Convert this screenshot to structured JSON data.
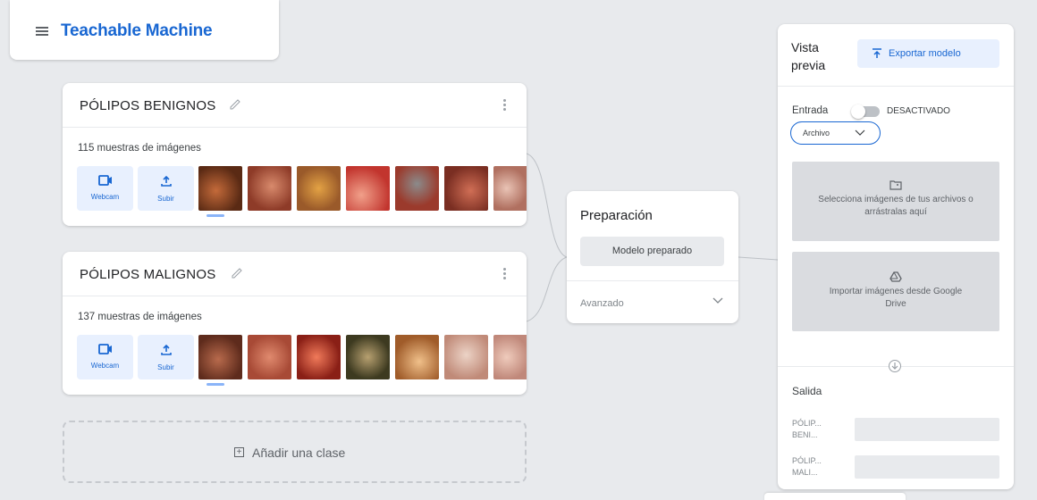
{
  "header": {
    "title": "Teachable Machine"
  },
  "classes": [
    {
      "name": "PÓLIPOS BENIGNOS",
      "sample_count": "115 muestras de imágenes",
      "webcam_label": "Webcam",
      "upload_label": "Subir",
      "thumbnails": [
        "#7a3b1e",
        "#a84a2a",
        "#c07d3f",
        "#d9544a",
        "#9b3a2c",
        "#b6523a",
        "#c98a7a"
      ]
    },
    {
      "name": "PÓLIPOS MALIGNOS",
      "sample_count": "137 muestras de imágenes",
      "webcam_label": "Webcam",
      "upload_label": "Subir",
      "thumbnails": [
        "#8c4a34",
        "#c26a52",
        "#b1382a",
        "#6b5a2a",
        "#c27d3c",
        "#d7a894",
        "#d6a38d"
      ]
    }
  ],
  "add_class": {
    "label": "Añadir una clase"
  },
  "training": {
    "title": "Preparación",
    "button_label": "Modelo preparado",
    "advanced_label": "Avanzado"
  },
  "preview": {
    "title": "Vista previa",
    "export_label": "Exportar modelo",
    "input_label": "Entrada",
    "toggle_state": "DESACTIVADO",
    "source_value": "Archivo",
    "file_drop_text": "Selecciona imágenes de tus archivos o arrástralas aquí",
    "drive_text": "Importar imágenes desde Google Drive",
    "output_label": "Salida",
    "outputs": [
      {
        "line1": "PÓLIP...",
        "line2": "BENI..."
      },
      {
        "line1": "PÓLIP...",
        "line2": "MALI..."
      }
    ]
  },
  "colors": {
    "accent": "#1967d2",
    "accent_light": "#e8f0fe",
    "background": "#e8eaed"
  }
}
